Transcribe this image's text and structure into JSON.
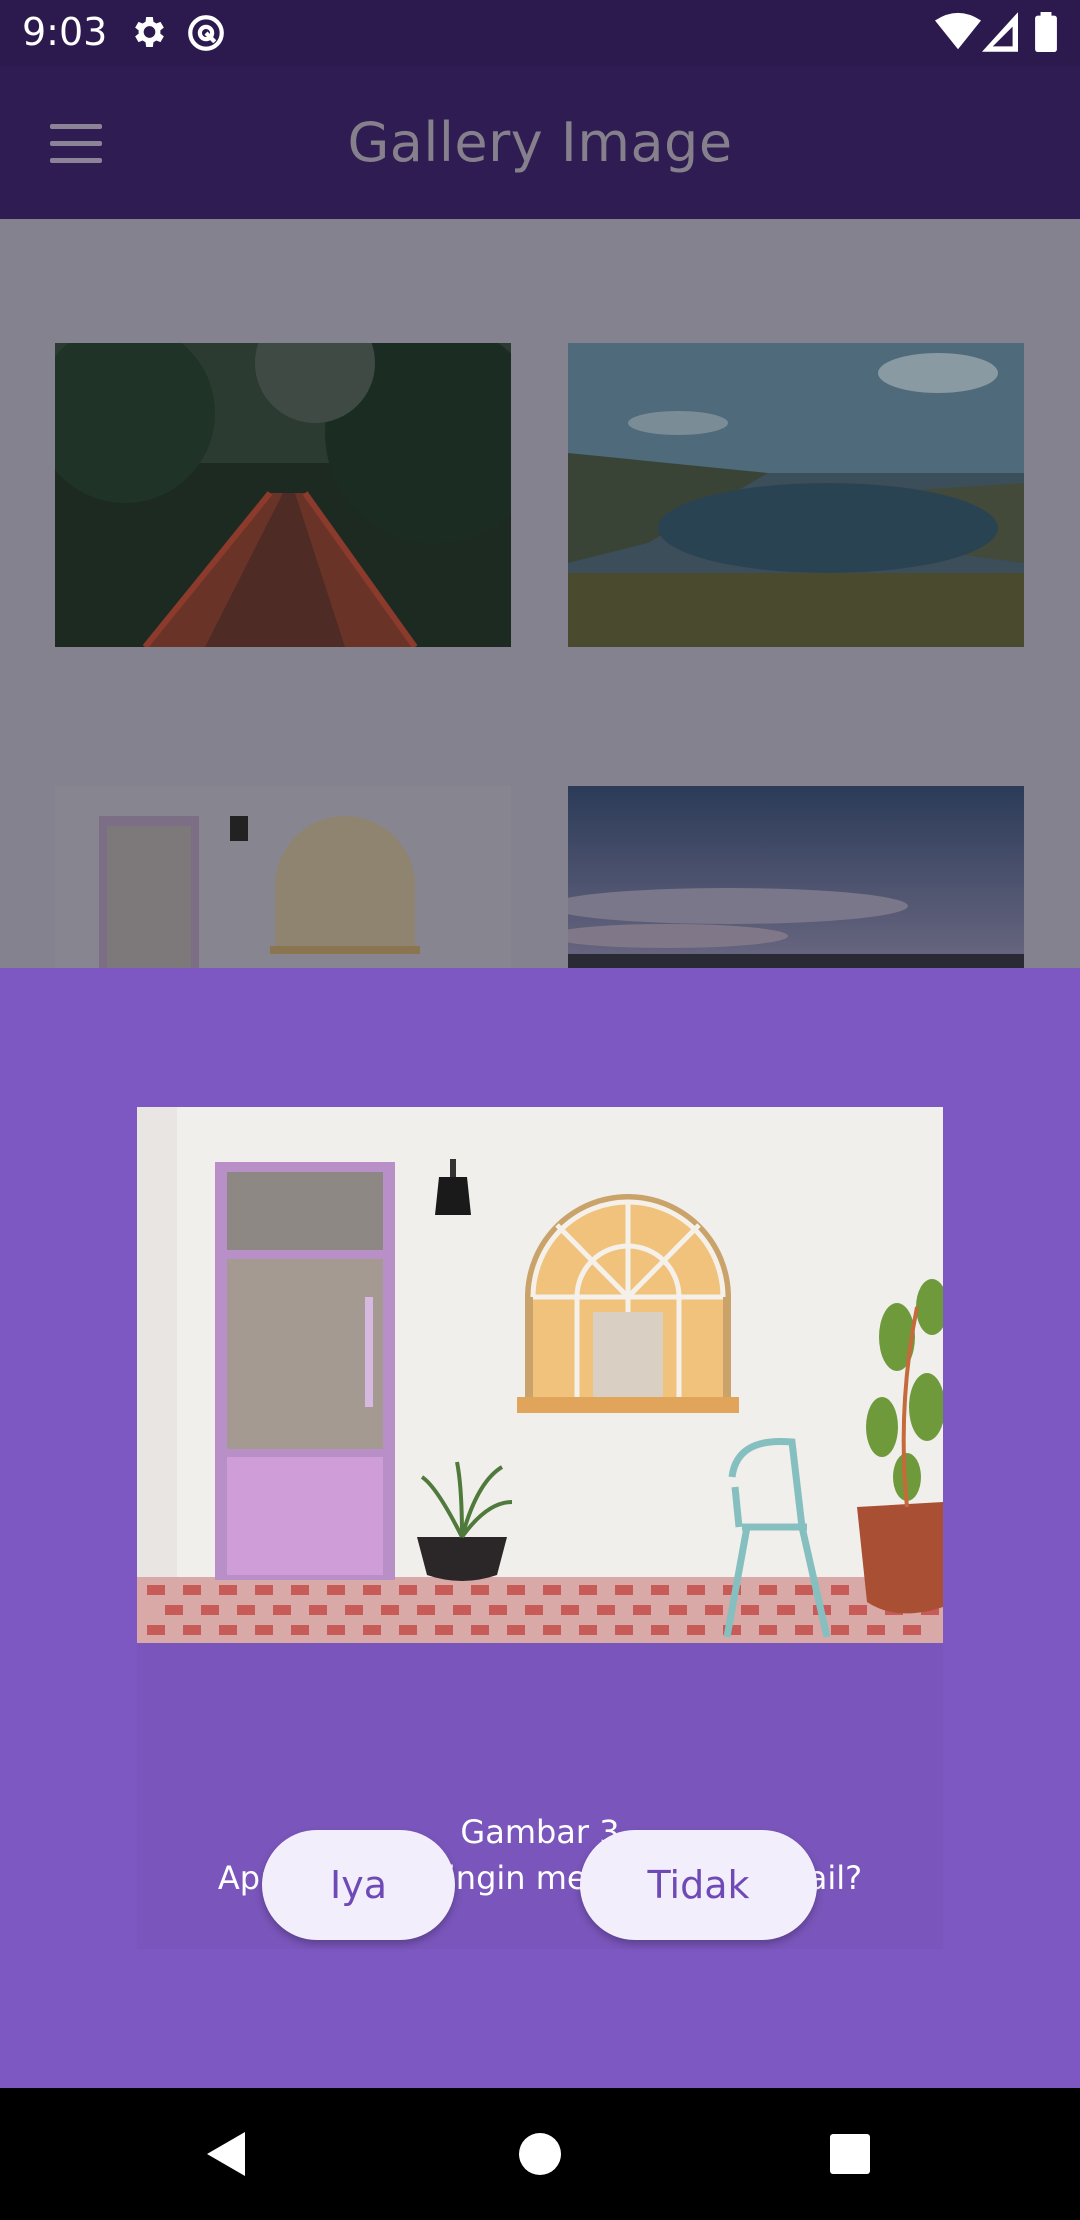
{
  "status_bar": {
    "time": "9:03",
    "icons_left": [
      "gear-icon",
      "at-sign-icon"
    ],
    "icons_right": [
      "wifi-icon",
      "signal-icon",
      "battery-icon"
    ]
  },
  "app_bar": {
    "title": "Gallery Image",
    "menu_icon": "hamburger-menu-icon"
  },
  "gallery": {
    "items": [
      {
        "subject": "forest-bridge"
      },
      {
        "subject": "lake-valley"
      },
      {
        "subject": "house-door-window"
      },
      {
        "subject": "sky-horizon"
      }
    ]
  },
  "dialog": {
    "title": "Gambar 3",
    "message": "Apakah kamu ingin melihat lebih detail?",
    "confirm_label": "Iya",
    "cancel_label": "Tidak"
  },
  "colors": {
    "app_bar": "#2e1c52",
    "sheet": "#7e58c2",
    "button_bg": "#f3eefb",
    "button_text": "#6f4ab6"
  },
  "nav_bar": {
    "buttons": [
      "back-icon",
      "home-icon",
      "recents-icon"
    ]
  }
}
